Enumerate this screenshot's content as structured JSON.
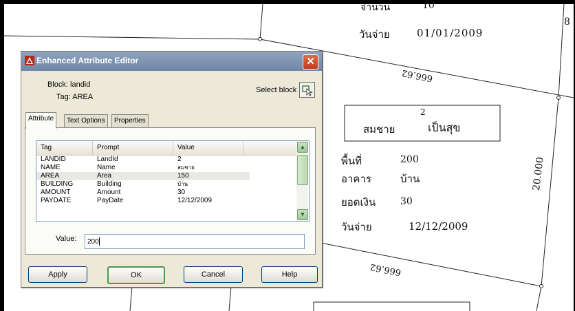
{
  "drawing": {
    "area_label_top": "666.62",
    "area_label_bottom": "666.62",
    "side_dimension": "20.000",
    "partial_right_label": "8",
    "top_label": "จำนวน",
    "top_value": "10",
    "paydate_top_label": "วันจ่าย",
    "paydate_top_value": "01/01/2009",
    "box_number": "2",
    "box_name": "สมชาย",
    "box_surname": "เป็นสุข",
    "area_label": "พื้นที่",
    "area_value": "200",
    "building_label": "อาคาร",
    "building_value": "บ้าน",
    "amount_label": "ยอดเงิน",
    "amount_value": "30",
    "paydate_label": "วันจ่าย",
    "paydate_value": "12/12/2009"
  },
  "dialog": {
    "title": "Enhanced Attribute Editor",
    "block_label": "Block: landid",
    "tag_label": "Tag: AREA",
    "select_block_label": "Select block",
    "tabs": [
      "Attribute",
      "Text Options",
      "Properties"
    ],
    "columns": [
      "Tag",
      "Prompt",
      "Value"
    ],
    "rows": [
      {
        "tag": "LANDID",
        "prompt": "LandId",
        "value": "2"
      },
      {
        "tag": "NAME",
        "prompt": "Name",
        "value": "สมชาย"
      },
      {
        "tag": "AREA",
        "prompt": "Area",
        "value": "150"
      },
      {
        "tag": "BUILDING",
        "prompt": "Building",
        "value": "บ้าน"
      },
      {
        "tag": "AMOUNT",
        "prompt": "Amount",
        "value": "30"
      },
      {
        "tag": "PAYDATE",
        "prompt": "PayDate",
        "value": "12/12/2009"
      }
    ],
    "selected_row_index": 2,
    "value_label": "Value:",
    "value_input": "200",
    "buttons": {
      "apply": "Apply",
      "ok": "OK",
      "cancel": "Cancel",
      "help": "Help"
    }
  },
  "colors": {
    "title_bar": "#7a8fb0",
    "close_button": "#d4502e",
    "dialog_bg": "#ece9d8"
  }
}
